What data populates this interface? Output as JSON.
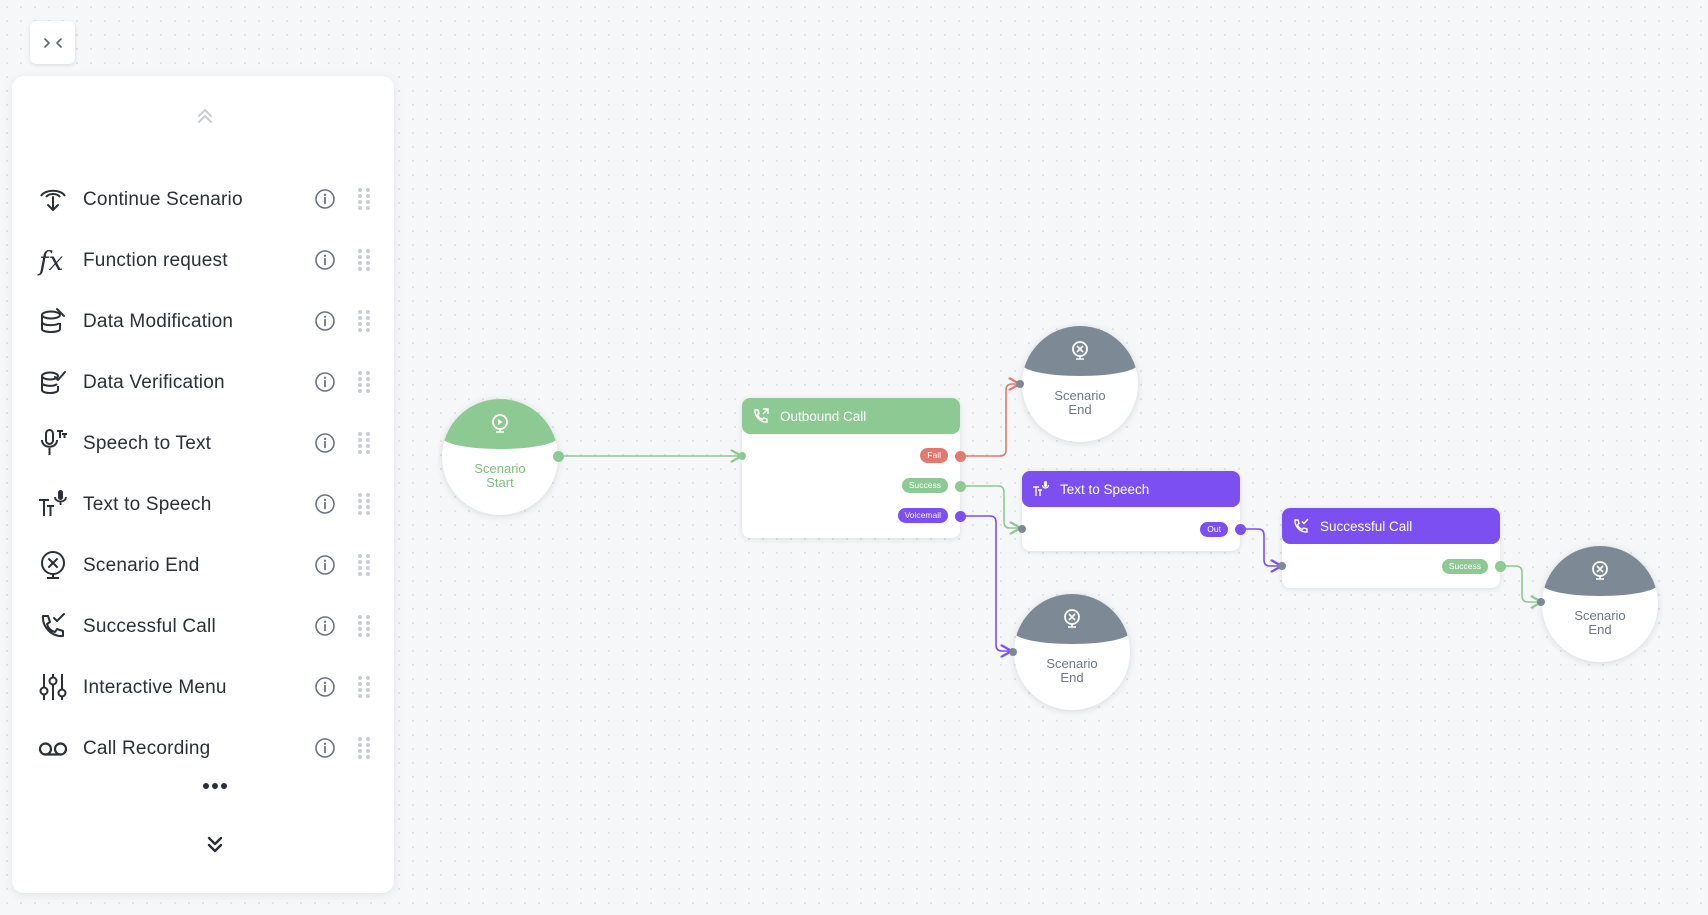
{
  "palette": {
    "items": [
      {
        "label": "Continue Scenario",
        "icon": "continue-scenario-icon"
      },
      {
        "label": "Function request",
        "icon": "function-icon"
      },
      {
        "label": "Data Modification",
        "icon": "data-modification-icon"
      },
      {
        "label": "Data Verification",
        "icon": "data-verification-icon"
      },
      {
        "label": "Speech to Text",
        "icon": "speech-to-text-icon"
      },
      {
        "label": "Text to Speech",
        "icon": "text-to-speech-icon"
      },
      {
        "label": "Scenario End",
        "icon": "scenario-end-icon"
      },
      {
        "label": "Successful Call",
        "icon": "successful-call-icon"
      },
      {
        "label": "Interactive Menu",
        "icon": "interactive-menu-icon"
      },
      {
        "label": "Call Recording",
        "icon": "call-recording-icon"
      }
    ]
  },
  "nodes": {
    "start": {
      "line1": "Scenario",
      "line2": "Start"
    },
    "outbound": {
      "title": "Outbound Call",
      "fail": "Fail",
      "success": "Success",
      "voicemail": "Voicemail"
    },
    "end_top": {
      "line1": "Scenario",
      "line2": "End"
    },
    "tts": {
      "title": "Text to Speech",
      "out": "Out"
    },
    "end_bottom": {
      "line1": "Scenario",
      "line2": "End"
    },
    "successful": {
      "title": "Successful Call",
      "success": "Success"
    },
    "end_right": {
      "line1": "Scenario",
      "line2": "End"
    }
  },
  "colors": {
    "green": "#8dc993",
    "purple": "#7b4ff0",
    "red": "#e07a6e",
    "gray": "#7d8a96"
  }
}
